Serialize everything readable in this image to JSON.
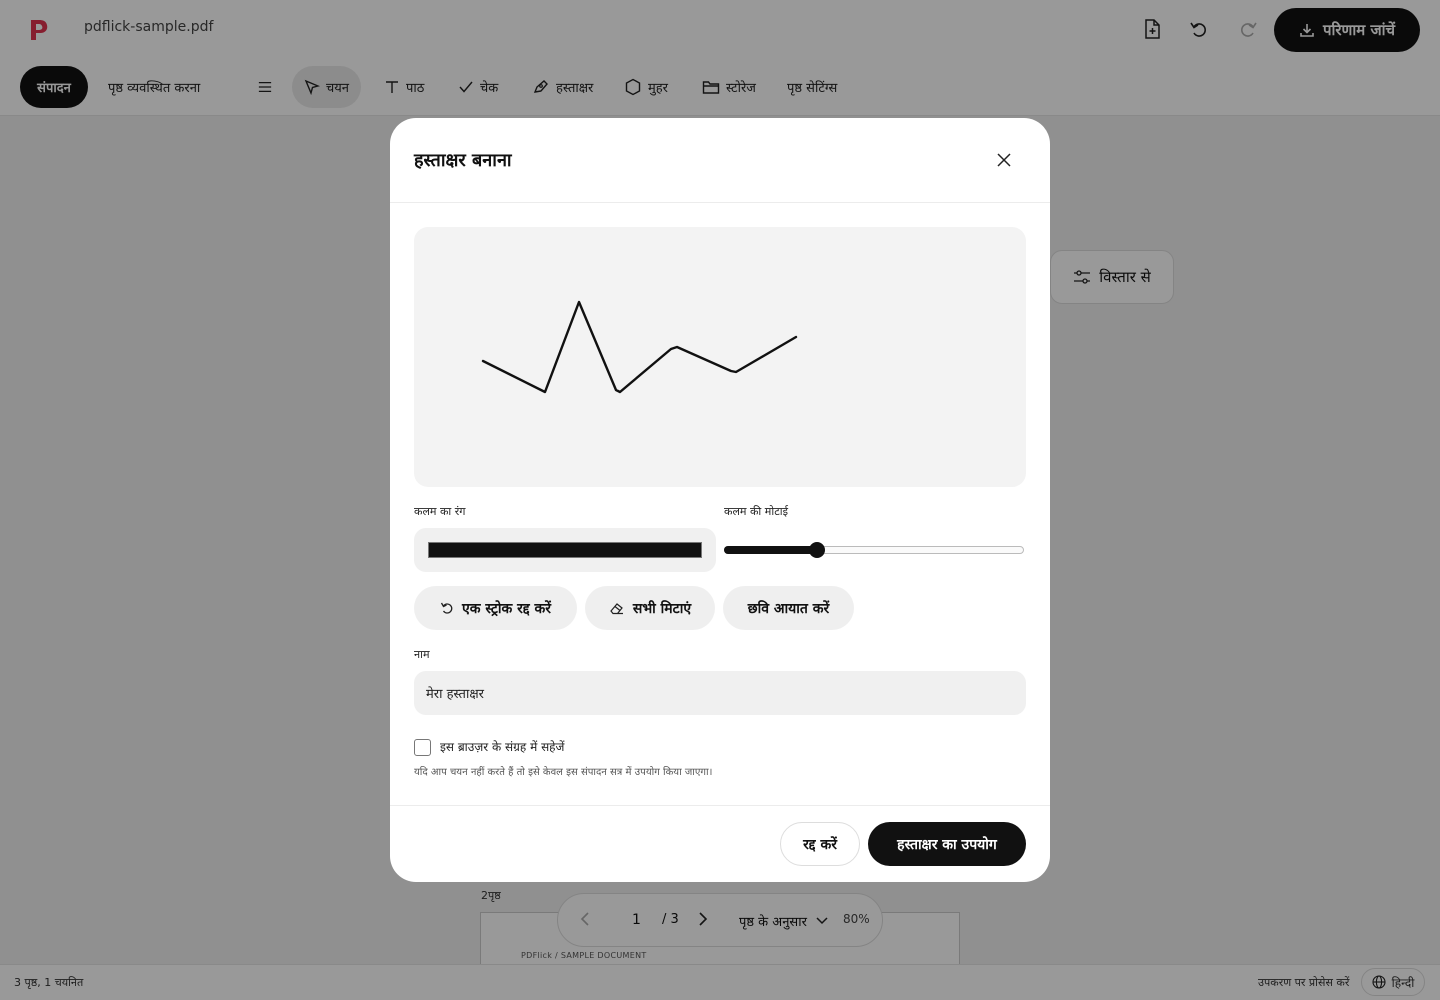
{
  "app": {
    "filename": "pdflick-sample.pdf",
    "brand_color": "#e0334f",
    "result_button_label": "परिणाम जांचें"
  },
  "toolbar": {
    "mode_edit": "संपादन",
    "mode_arrange": "पृष्ठ व्यवस्थित करना",
    "tools": {
      "select": "चयन",
      "text": "पाठ",
      "check": "चेक",
      "signature": "हस्ताक्षर",
      "stamp": "मुहर",
      "storage": "स्टोरेज",
      "page_settings": "पृष्ठ सेटिंग्स"
    }
  },
  "canvas": {
    "detail_button": "विस्तार से",
    "page_label": "2पृष्ठ",
    "sheet_header": "PDFlick / SAMPLE DOCUMENT"
  },
  "pager": {
    "current_page": "1",
    "total": "/ 3",
    "fit_mode": "पृष्ठ के अनुसार",
    "zoom": "80%"
  },
  "status": {
    "left": "3 पृष्ठ, 1 चयनित",
    "process": "उपकरण पर प्रोसेस करें",
    "language": "हिन्दी"
  },
  "modal": {
    "title": "हस्ताक्षर बनाना",
    "pen_color_label": "कलम का रंग",
    "pen_color": "#111111",
    "pen_width_label": "कलम की मोटाई",
    "pen_width_fraction": 0.31,
    "undo_stroke": "एक स्ट्रोक रद्द करें",
    "clear_all": "सभी मिटाएं",
    "import_image": "छवि आयात करें",
    "name_label": "नाम",
    "name_value": "मेरा हस्ताक्षर",
    "save_label": "इस ब्राउज़र के संग्रह में सहेजें",
    "save_checked": false,
    "hint": "यदि आप चयन नहीं करते हैं तो इसे केवल इस संपादन सत्र में उपयोग किया जाएगा।",
    "cancel": "रद्द करें",
    "use": "हस्ताक्षर का उपयोग"
  }
}
